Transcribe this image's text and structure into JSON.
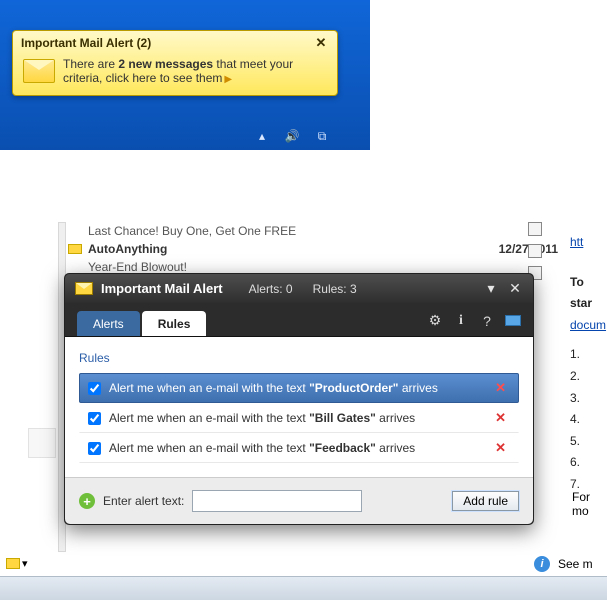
{
  "toast": {
    "title": "Important Mail Alert (2)",
    "line1_pre": "There are ",
    "line1_bold": "2 new messages",
    "line1_post": " that meet your",
    "line2": "criteria, click here to see them"
  },
  "mail": {
    "subj1": "Last Chance! Buy One, Get One FREE",
    "sender": "AutoAnything",
    "date": "12/27/2011",
    "subj2": "Year-End Blowout!"
  },
  "rightcol": {
    "http": "htt",
    "heading": "To star",
    "link": "docum",
    "items": [
      "1.",
      "2.",
      "3.",
      "4.",
      "5.",
      "6.",
      "7."
    ],
    "formore": "For mo",
    "seemore": "See m"
  },
  "dialog": {
    "title": "Important Mail Alert",
    "alerts_label": "Alerts: 0",
    "rules_label": "Rules: 3",
    "tab_alerts": "Alerts",
    "tab_rules": "Rules",
    "section": "Rules",
    "rules": [
      {
        "pre": "Alert me when an e-mail with the text ",
        "kw": "\"ProductOrder\"",
        "post": " arrives",
        "selected": true
      },
      {
        "pre": "Alert me when an e-mail with the text ",
        "kw": "\"Bill Gates\"",
        "post": " arrives",
        "selected": false
      },
      {
        "pre": "Alert me when an e-mail with the text ",
        "kw": "\"Feedback\"",
        "post": " arrives",
        "selected": false
      }
    ],
    "footer_label": "Enter alert text:",
    "footer_input": "",
    "add_btn": "Add rule"
  }
}
